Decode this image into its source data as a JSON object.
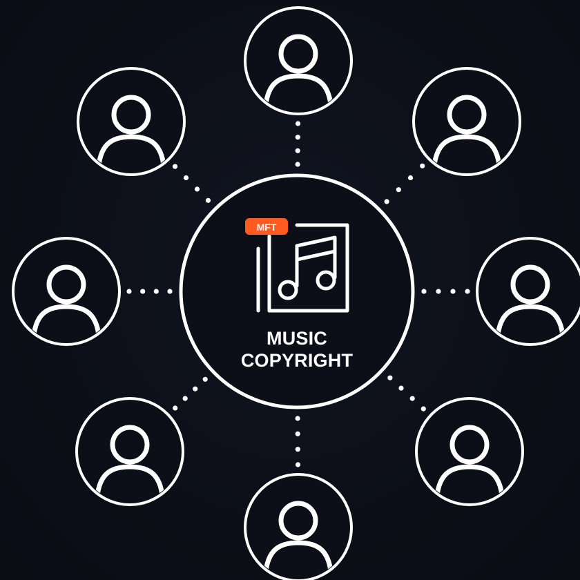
{
  "center": {
    "line1": "MUSIC",
    "line2": "COPYRIGHT",
    "badge": "MFT",
    "icon": "music-album-icon"
  },
  "nodes": [
    {
      "id": "top",
      "icon": "user-icon"
    },
    {
      "id": "top-right",
      "icon": "user-icon"
    },
    {
      "id": "right",
      "icon": "user-icon"
    },
    {
      "id": "bottom-right",
      "icon": "user-icon"
    },
    {
      "id": "bottom",
      "icon": "user-icon"
    },
    {
      "id": "bottom-left",
      "icon": "user-icon"
    },
    {
      "id": "left",
      "icon": "user-icon"
    },
    {
      "id": "top-left",
      "icon": "user-icon"
    }
  ],
  "colors": {
    "background": "#0c0f17",
    "stroke": "#ffffff",
    "badge": "#ff5a1f"
  }
}
